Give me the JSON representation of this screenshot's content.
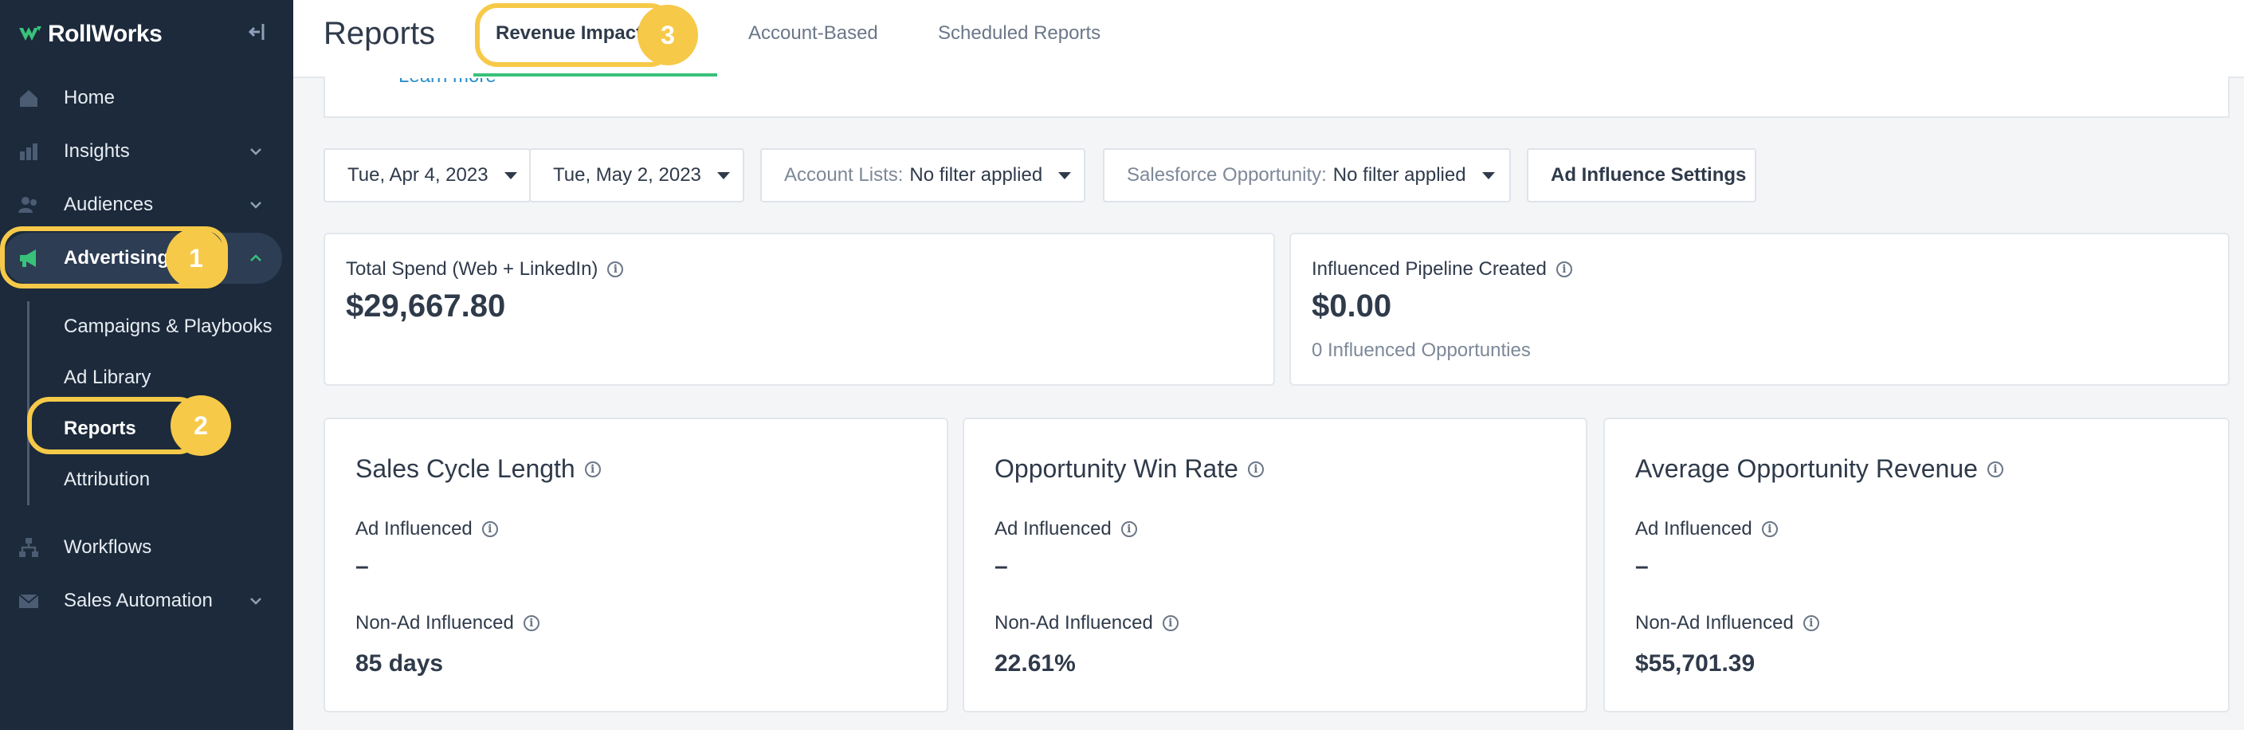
{
  "sidebar": {
    "brand": "RollWorks",
    "nav": [
      {
        "label": "Home",
        "icon": "home-icon"
      },
      {
        "label": "Insights",
        "icon": "insights-icon"
      },
      {
        "label": "Audiences",
        "icon": "audiences-icon"
      },
      {
        "label": "Advertising",
        "icon": "megaphone-icon"
      },
      {
        "label": "Workflows",
        "icon": "workflows-icon"
      },
      {
        "label": "Sales Automation",
        "icon": "mail-icon"
      }
    ],
    "sub_items": [
      "Campaigns & Playbooks",
      "Ad Library",
      "Reports",
      "Attribution"
    ]
  },
  "callouts": [
    "1",
    "2",
    "3"
  ],
  "header": {
    "title": "Reports",
    "tabs": [
      "Revenue Impact",
      "Account-Based",
      "Scheduled Reports"
    ]
  },
  "top_card": {
    "link": "Learn more"
  },
  "filters": {
    "start_date": "Tue, Apr 4, 2023",
    "end_date": "Tue, May 2, 2023",
    "account_lists_label": "Account Lists:",
    "account_lists_value": "No filter applied",
    "sf_label": "Salesforce Opportunity:",
    "sf_value": "No filter applied",
    "settings_button": "Ad Influence Settings"
  },
  "summary": {
    "spend_label": "Total Spend (Web + LinkedIn)",
    "spend_value": "$29,667.80",
    "pipeline_label": "Influenced Pipeline Created",
    "pipeline_value": "$0.00",
    "pipeline_sub": "0 Influenced Opportunties"
  },
  "metrics": [
    {
      "title": "Sales Cycle Length",
      "ad_label": "Ad Influenced",
      "ad_value": "–",
      "non_label": "Non-Ad Influenced",
      "non_value": "85 days"
    },
    {
      "title": "Opportunity Win Rate",
      "ad_label": "Ad Influenced",
      "ad_value": "–",
      "non_label": "Non-Ad Influenced",
      "non_value": "22.61%"
    },
    {
      "title": "Average Opportunity Revenue",
      "ad_label": "Ad Influenced",
      "ad_value": "–",
      "non_label": "Non-Ad Influenced",
      "non_value": "$55,701.39"
    }
  ],
  "colors": {
    "sidebar_bg": "#1c2a3b",
    "accent_green": "#38c27a",
    "callout_yellow": "#f6c948",
    "link_blue": "#2b8fc9"
  }
}
